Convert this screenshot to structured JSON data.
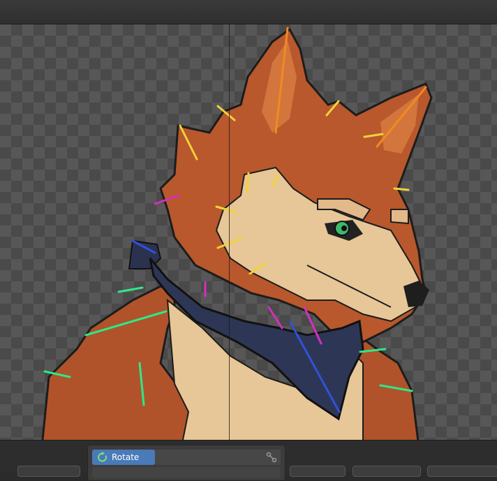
{
  "toolbar": {
    "active_tool_label": "Rotate",
    "active_tool_icon": "rotate-icon",
    "link_icon": "bone-link-icon"
  },
  "colors": {
    "accent": "#4a7ab8",
    "checker_light": "#575757",
    "checker_dark": "#4a4a4a"
  },
  "canvas": {
    "subject": "wolf-character-illustration"
  }
}
